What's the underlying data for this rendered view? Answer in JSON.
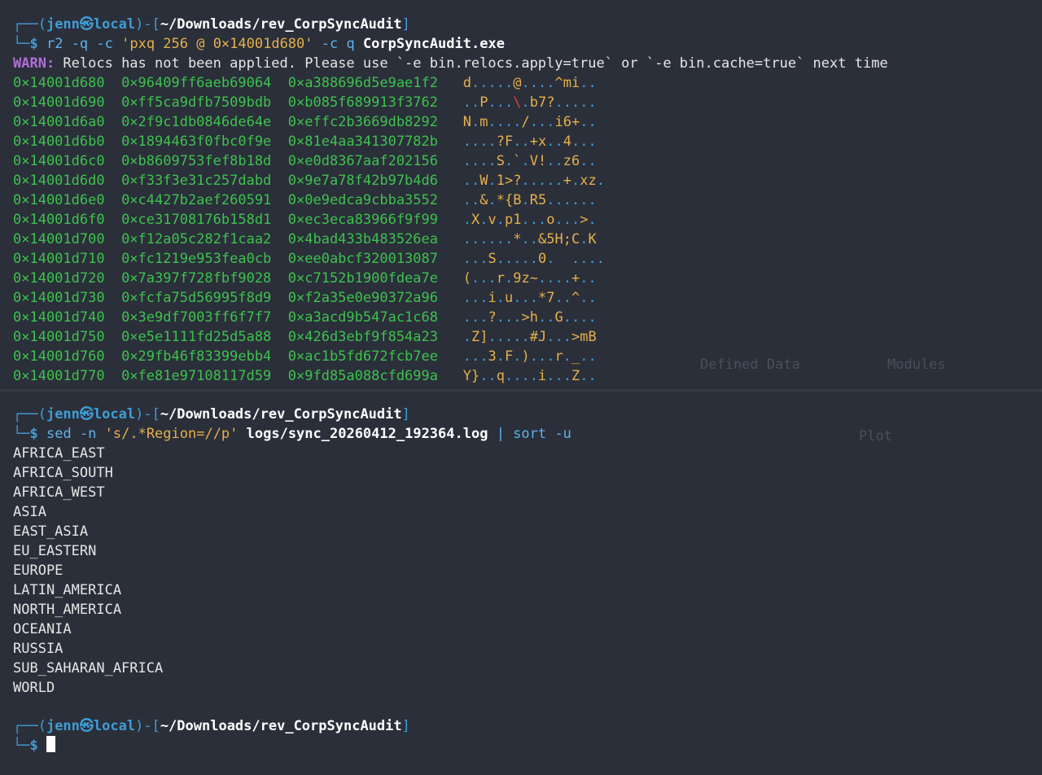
{
  "prompt": {
    "user": "jenn",
    "at": "㉿",
    "host": "local",
    "cwd": "~/Downloads/rev_CorpSyncAudit"
  },
  "cmd1": {
    "name": "r2",
    "args": " -q -c ",
    "quoted": "'pxq 256 @ 0×14001d680'",
    "args2": " -c q ",
    "target": "CorpSyncAudit.exe"
  },
  "warn": {
    "label": "WARN:",
    "text": " Relocs has not been applied. Please use `-e bin.relocs.apply=true` or `-e bin.cache=true` next time"
  },
  "dump": [
    {
      "addr": "0×14001d680",
      "q1": "0×96409ff6aeb69064",
      "q2": "0×a388696d5e9ae1f2",
      "ascii": "d.....@....^mi.."
    },
    {
      "addr": "0×14001d690",
      "q1": "0×ff5ca9dfb7509bdb",
      "q2": "0×b085f689913f3762",
      "ascii": "..P...\\.b7?....."
    },
    {
      "addr": "0×14001d6a0",
      "q1": "0×2f9c1db0846de64e",
      "q2": "0×effc2b3669db8292",
      "ascii": "N.m..../...i6+.."
    },
    {
      "addr": "0×14001d6b0",
      "q1": "0×1894463f0fbc0f9e",
      "q2": "0×81e4aa341307782b",
      "ascii": "....?F..+x..4..."
    },
    {
      "addr": "0×14001d6c0",
      "q1": "0×b8609753fef8b18d",
      "q2": "0×e0d8367aaf202156",
      "ascii": "....S.`.V!..z6.."
    },
    {
      "addr": "0×14001d6d0",
      "q1": "0×f33f3e31c257dabd",
      "q2": "0×9e7a78f42b97b4d6",
      "ascii": "..W.1>?.....+.xz."
    },
    {
      "addr": "0×14001d6e0",
      "q1": "0×c4427b2aef260591",
      "q2": "0×0e9edca9cbba3552",
      "ascii": "..&.*{B.R5......"
    },
    {
      "addr": "0×14001d6f0",
      "q1": "0×ce31708176b158d1",
      "q2": "0×ec3eca83966f9f99",
      "ascii": ".X.v.p1...o...>."
    },
    {
      "addr": "0×14001d700",
      "q1": "0×f12a05c282f1caa2",
      "q2": "0×4bad433b483526ea",
      "ascii": "......*..&5H;C.K"
    },
    {
      "addr": "0×14001d710",
      "q1": "0×fc1219e953fea0cb",
      "q2": "0×ee0abcf320013087",
      "ascii": "...S.....0.  ...."
    },
    {
      "addr": "0×14001d720",
      "q1": "0×7a397f728fbf9028",
      "q2": "0×c7152b1900fdea7e",
      "ascii": "(...r.9z~....+.."
    },
    {
      "addr": "0×14001d730",
      "q1": "0×fcfa75d56995f8d9",
      "q2": "0×f2a35e0e90372a96",
      "ascii": "...i.u...*7..^.."
    },
    {
      "addr": "0×14001d740",
      "q1": "0×3e9df7003ff6f7f7",
      "q2": "0×a3acd9b547ac1c68",
      "ascii": "...?...>h..G...."
    },
    {
      "addr": "0×14001d750",
      "q1": "0×e5e1111fd25d5a88",
      "q2": "0×426d3ebf9f854a23",
      "ascii": ".Z].....#J...>mB"
    },
    {
      "addr": "0×14001d760",
      "q1": "0×29fb46f83399ebb4",
      "q2": "0×ac1b5fd672fcb7ee",
      "ascii": "...3.F.)...r._.."
    },
    {
      "addr": "0×14001d770",
      "q1": "0×fe81e97108117d59",
      "q2": "0×9fd85a088cfd699a",
      "ascii": "Y}..q....i...Z.."
    }
  ],
  "cmd2": {
    "name": "sed",
    "args": " -n ",
    "quoted": "'s/.*Region=//p'",
    "file": " logs/sync_20260412_192364.log ",
    "pipe": "|",
    "sort": " sort -u"
  },
  "regions": [
    "AFRICA_EAST",
    "AFRICA_SOUTH",
    "AFRICA_WEST",
    "ASIA",
    "EAST_ASIA",
    "EU_EASTERN",
    "EUROPE",
    "LATIN_AMERICA",
    "NORTH_AMERICA",
    "OCEANIA",
    "RUSSIA",
    "SUB_SAHARAN_AFRICA",
    "WORLD"
  ],
  "ghost": {
    "defined_data": "Defined Data",
    "modules": "Modules",
    "plot": "Plot"
  }
}
